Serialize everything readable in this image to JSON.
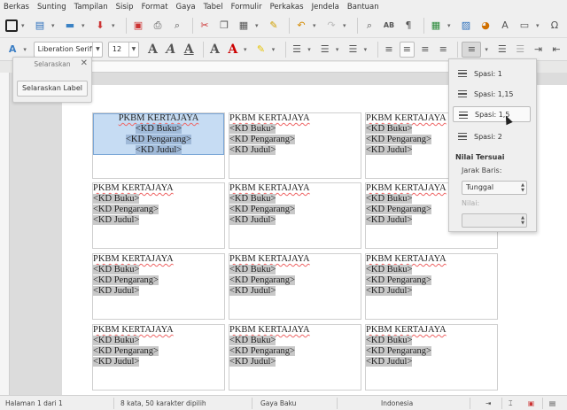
{
  "menu": [
    "Berkas",
    "Sunting",
    "Tampilan",
    "Sisip",
    "Format",
    "Gaya",
    "Tabel",
    "Formulir",
    "Perkakas",
    "Jendela",
    "Bantuan"
  ],
  "format_bar": {
    "font_name": "Liberation Serif",
    "font_size": "12"
  },
  "float_dialog": {
    "title": "Selaraskan",
    "button": "Selaraskan Label"
  },
  "spacing_popup": {
    "options": [
      "Spasi: 1",
      "Spasi: 1,15",
      "Spasi: 1,5",
      "Spasi: 2"
    ],
    "highlighted_index": 2,
    "custom_title": "Nilai Tersuai",
    "line_spacing_label": "Jarak Baris:",
    "line_spacing_value": "Tunggal",
    "value_label": "Nilai:"
  },
  "labels": {
    "title": "PKBM KERTAJAYA",
    "field1": "<KD Buku>",
    "field2": "<KD Pengarang>",
    "field3": "<KD Judul>"
  },
  "status": {
    "page": "Halaman 1 dari 1",
    "words": "8 kata, 50 karakter dipilih",
    "style": "Gaya Baku",
    "language": "Indonesia"
  }
}
